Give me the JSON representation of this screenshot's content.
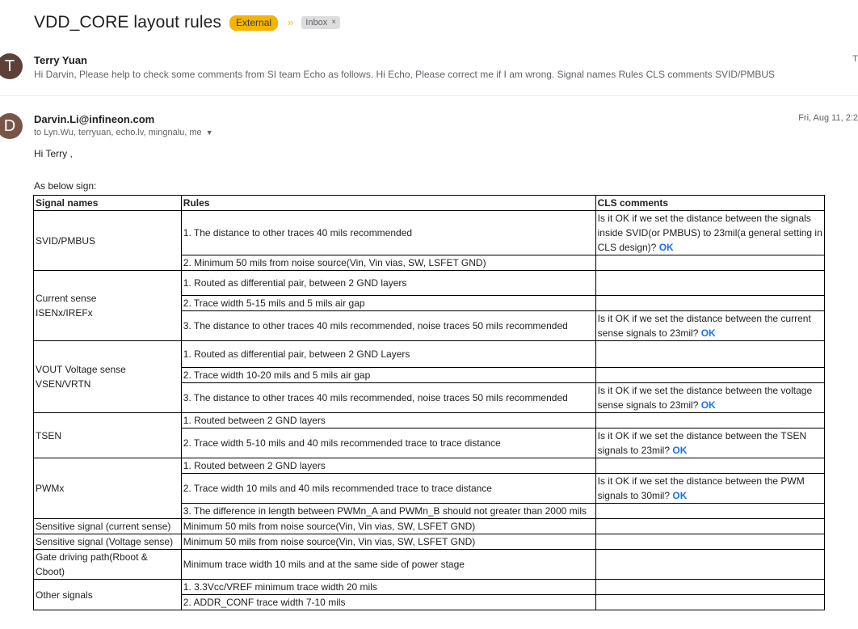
{
  "subject": "VDD_CORE layout rules",
  "labels": {
    "external": "External",
    "inbox": "Inbox",
    "inbox_close": "×",
    "importance": "»"
  },
  "messages": [
    {
      "avatar": "T",
      "sender": "Terry Yuan",
      "snippet": "Hi Darvin, Please help to check some comments from SI team Echo as follows. Hi Echo, Please correct me if I am wrong. Signal names Rules CLS comments SVID/PMBUS",
      "right_edge": "T"
    },
    {
      "avatar": "D",
      "sender": "Darvin.Li@infineon.com",
      "date": "Fri, Aug 11, 2:2",
      "recipients": "to Lyn.Wu, terryuan, echo.lv, mingnalu, me",
      "greeting": "Hi Terry ,",
      "intro": "As below sign:"
    }
  ],
  "table": {
    "headers": [
      "Signal names",
      "Rules",
      "CLS comments"
    ],
    "signal_names": {
      "svid": "SVID/PMBUS",
      "current_1": "Current sense",
      "current_2": "ISENx/IREFx",
      "vout_1": "VOUT Voltage sense",
      "vout_2": "VSEN/VRTN",
      "tsen": "TSEN",
      "pwm": "PWMx",
      "sens_current": "Sensitive signal (current sense)",
      "sens_voltage": "Sensitive signal  (Voltage sense)",
      "gate": "Gate driving path(Rboot & Cboot)",
      "other": "Other signals"
    },
    "rules": {
      "svid_1": "1. The distance to other traces 40 mils recommended",
      "svid_2": "2. Minimum 50 mils  from noise source(Vin, Vin vias, SW, LSFET GND)",
      "current_1": "1. Routed as differential pair, between 2 GND layers",
      "current_2": "2. Trace width 5-15 mils and 5 mils air gap",
      "current_3": "3. The distance to other traces 40 mils recommended, noise traces 50 mils recommended",
      "vout_1": "1. Routed as differential pair, between 2 GND Layers",
      "vout_2": "2. Trace width 10-20 mils and 5 mils air gap",
      "vout_3": "3. The distance to other traces 40 mils recommended, noise traces 50 mils recommended",
      "tsen_1": "1. Routed between 2 GND layers",
      "tsen_2": "2. Trace width 5-10 mils and 40 mils recommended trace to trace distance",
      "pwm_1": "1. Routed between 2 GND layers",
      "pwm_2": "2. Trace width 10 mils and 40 mils recommended trace to trace distance",
      "pwm_3": "3. The difference in length between PWMn_A and PWMn_B should not greater than 2000 mils",
      "sens_current": "Minimum 50 mils  from noise source(Vin, Vin vias, SW, LSFET GND)",
      "sens_voltage": "Minimum 50 mils from noise source(Vin, Vin vias, SW, LSFET GND)",
      "gate": "Minimum trace width 10 mils and at the same side of power stage",
      "other_1": "1. 3.3Vcc/VREF minimum trace width 20 mils",
      "other_2": "2. ADDR_CONF trace width 7-10 mils"
    },
    "comments": {
      "svid": "Is it OK if we set the distance between the signals inside SVID(or PMBUS) to 23mil(a general setting in CLS design)? ",
      "current": "Is it OK if we set the distance between the current sense signals to 23mil? ",
      "vout": "Is it OK if we set the distance between the voltage sense signals to 23mil? ",
      "tsen": "Is it OK if we set the distance between the TSEN signals to 23mil? ",
      "pwm": "Is it OK if we set the distance between the PWM signals to 30mil? ",
      "ok": "OK"
    }
  },
  "colors": {
    "external_badge": "#f4b400",
    "ok_link": "#1a73e8",
    "avatar_t": "#5d4037",
    "avatar_d": "#795548"
  }
}
